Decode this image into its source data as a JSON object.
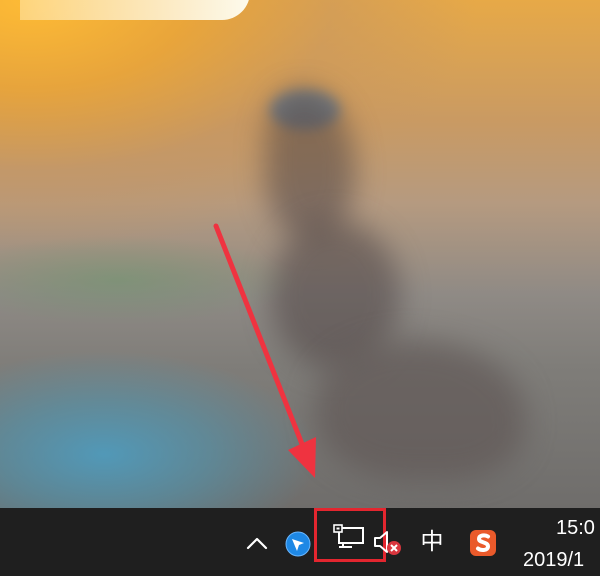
{
  "taskbar": {
    "clock": {
      "time": "15:0",
      "date": "2019/1"
    },
    "ime_label": "中",
    "icons": {
      "show_hidden": "chevron-up-icon",
      "app": "blue-pin-icon",
      "network": "network-disconnected-icon",
      "volume": "volume-muted-icon",
      "ime": "input-method-icon",
      "sogou": "sogou-input-icon"
    }
  },
  "colors": {
    "taskbar": "#1f1f1f",
    "annotation_red": "#e3262f",
    "sogou_orange": "#ea5a2b",
    "app_blue": "#1e88e5",
    "mute_red": "#d9363e"
  }
}
